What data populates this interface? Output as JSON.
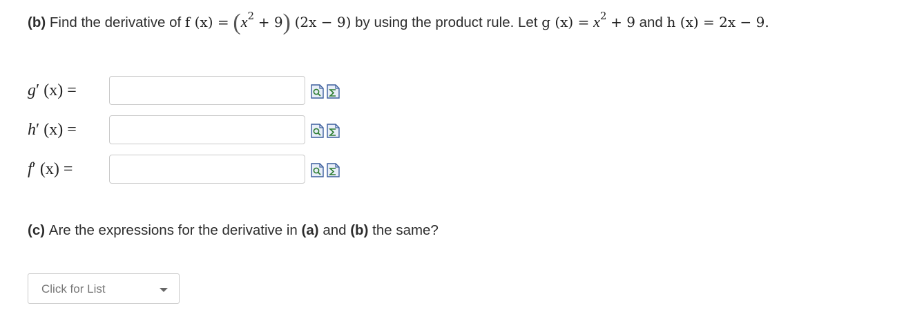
{
  "part_b": {
    "label": "(b)",
    "text_1": "Find the derivative of",
    "f_of_x": "f (x) =",
    "expr_open": "(",
    "expr_x": "x",
    "expr_sup": "2",
    "expr_plus9": "+ 9",
    "expr_close": ")",
    "expr_second": "(2x − 9)",
    "text_2": "by using the product rule. Let",
    "g_def_lhs": "g (x) =",
    "g_def_x": "x",
    "g_def_sup": "2",
    "g_def_rest": "+ 9",
    "text_and": "and",
    "h_def": "h (x) = 2x − 9."
  },
  "answers": [
    {
      "label_fn": "g",
      "label_rest": "′ (x) =",
      "value": "",
      "placeholder": ""
    },
    {
      "label_fn": "h",
      "label_rest": "′ (x) =",
      "value": "",
      "placeholder": ""
    },
    {
      "label_fn": "f",
      "label_rest": "′ (x) =",
      "value": "",
      "placeholder": ""
    }
  ],
  "icons": {
    "preview": "preview-icon",
    "equation": "equation-editor-icon"
  },
  "part_c": {
    "label_c": "(c)",
    "text_1": "Are the expressions for the derivative in",
    "label_a": "(a)",
    "text_and": "and",
    "label_b": "(b)",
    "text_2": "the same?"
  },
  "dropdown": {
    "selected": "Click for List"
  },
  "colors": {
    "icon_blue": "#3a5d9c",
    "icon_green": "#2e7d32",
    "border": "#c9c9c9"
  }
}
